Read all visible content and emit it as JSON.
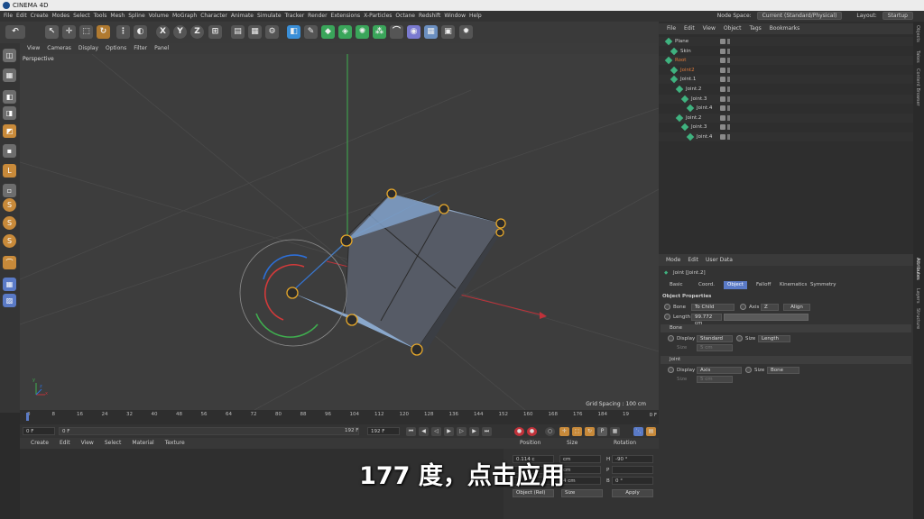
{
  "app": {
    "title": "CINEMA 4D"
  },
  "menubar": {
    "items": [
      "File",
      "Edit",
      "Create",
      "Modes",
      "Select",
      "Tools",
      "Mesh",
      "Spline",
      "Volume",
      "MoGraph",
      "Character",
      "Animate",
      "Simulate",
      "Tracker",
      "Render",
      "Extensions",
      "X-Particles",
      "Octane",
      "Redshift",
      "Window",
      "Help"
    ],
    "node_space_label": "Node Space:",
    "node_space_value": "Current (Standard/Physical)",
    "layout_label": "Layout:",
    "layout_value": "Startup"
  },
  "toolbar": {
    "axis_x": "X",
    "axis_y": "Y",
    "axis_z": "Z"
  },
  "viewport_menu": {
    "items": [
      "View",
      "Cameras",
      "Display",
      "Options",
      "Filter",
      "Panel"
    ]
  },
  "viewport": {
    "label": "Perspective",
    "grid_spacing": "Grid Spacing : 100 cm",
    "axis_x": "x",
    "axis_y": "y",
    "axis_z": "z"
  },
  "timeline": {
    "ticks": [
      "0",
      "8",
      "16",
      "24",
      "32",
      "40",
      "48",
      "56",
      "64",
      "72",
      "80",
      "88",
      "96",
      "104",
      "112",
      "120",
      "128",
      "136",
      "144",
      "152",
      "160",
      "168",
      "176",
      "184",
      "19"
    ],
    "current_frame": "0 F"
  },
  "transport": {
    "start": "0 F",
    "current": "0 F",
    "end": "192 F",
    "end2": "192 F"
  },
  "material_manager": {
    "menu": [
      "Create",
      "Edit",
      "View",
      "Select",
      "Material",
      "Texture"
    ]
  },
  "coordinates": {
    "headers": [
      "Position",
      "Size",
      "Rotation"
    ],
    "rows": [
      {
        "pos": "0.114 c",
        "size": "cm",
        "rot_label": "H",
        "rot": "-90 °"
      },
      {
        "pos": "",
        "size": "cm",
        "rot_label": "P",
        "rot": ""
      },
      {
        "pos": "",
        "size": "4 cm",
        "rot_label": "B",
        "rot": "0 °"
      }
    ],
    "mode": "Object (Rel)",
    "size_mode": "Size",
    "apply": "Apply"
  },
  "object_manager": {
    "menu": [
      "File",
      "Edit",
      "View",
      "Object",
      "Tags",
      "Bookmarks"
    ],
    "objects": [
      {
        "name": "Plane",
        "indent": 0,
        "color": "#cfcfcf"
      },
      {
        "name": "Skin",
        "indent": 1,
        "color": "#cfcfcf"
      },
      {
        "name": "Root",
        "indent": 0,
        "color": "#e07a3a"
      },
      {
        "name": "Joint2",
        "indent": 1,
        "color": "#e07a3a"
      },
      {
        "name": "Joint.1",
        "indent": 1,
        "color": "#cfcfcf"
      },
      {
        "name": "Joint.2",
        "indent": 2,
        "color": "#cfcfcf"
      },
      {
        "name": "Joint.3",
        "indent": 3,
        "color": "#cfcfcf"
      },
      {
        "name": "Joint.4",
        "indent": 4,
        "color": "#cfcfcf"
      },
      {
        "name": "Joint.2",
        "indent": 2,
        "color": "#cfcfcf"
      },
      {
        "name": "Joint.3",
        "indent": 3,
        "color": "#cfcfcf"
      },
      {
        "name": "Joint.4",
        "indent": 4,
        "color": "#cfcfcf"
      }
    ]
  },
  "attributes": {
    "menu": [
      "Mode",
      "Edit",
      "User Data"
    ],
    "object_title": "Joint [Joint.2]",
    "tabs": [
      "Basic",
      "Coord.",
      "Object",
      "Falloff",
      "Kinematics",
      "Symmetry"
    ],
    "active_tab": "Object",
    "section_title": "Object Properties",
    "bone_label": "Bone",
    "bone_value": "To Child",
    "axis_label": "Axis",
    "axis_value": "Z",
    "align_label": "Align",
    "length_label": "Length",
    "length_value": "99.772 cm",
    "bone_group": "Bone",
    "bone_display_label": "Display",
    "bone_display_value": "Standard",
    "bone_size_label": "Size",
    "bone_size_value": "Length",
    "bone_size2_label": "Size",
    "bone_size2_value": "5 cm",
    "joint_group": "Joint",
    "joint_display_label": "Display",
    "joint_display_value": "Axis",
    "joint_size_label": "Size",
    "joint_size_value": "Bone",
    "joint_size2_label": "Size",
    "joint_size2_value": "5 cm"
  },
  "right_strip": {
    "tabs": [
      "Objects",
      "Takes",
      "Content Browser",
      "Attributes",
      "Layers",
      "Structure"
    ]
  },
  "subtitle": "177 度，点击应用"
}
